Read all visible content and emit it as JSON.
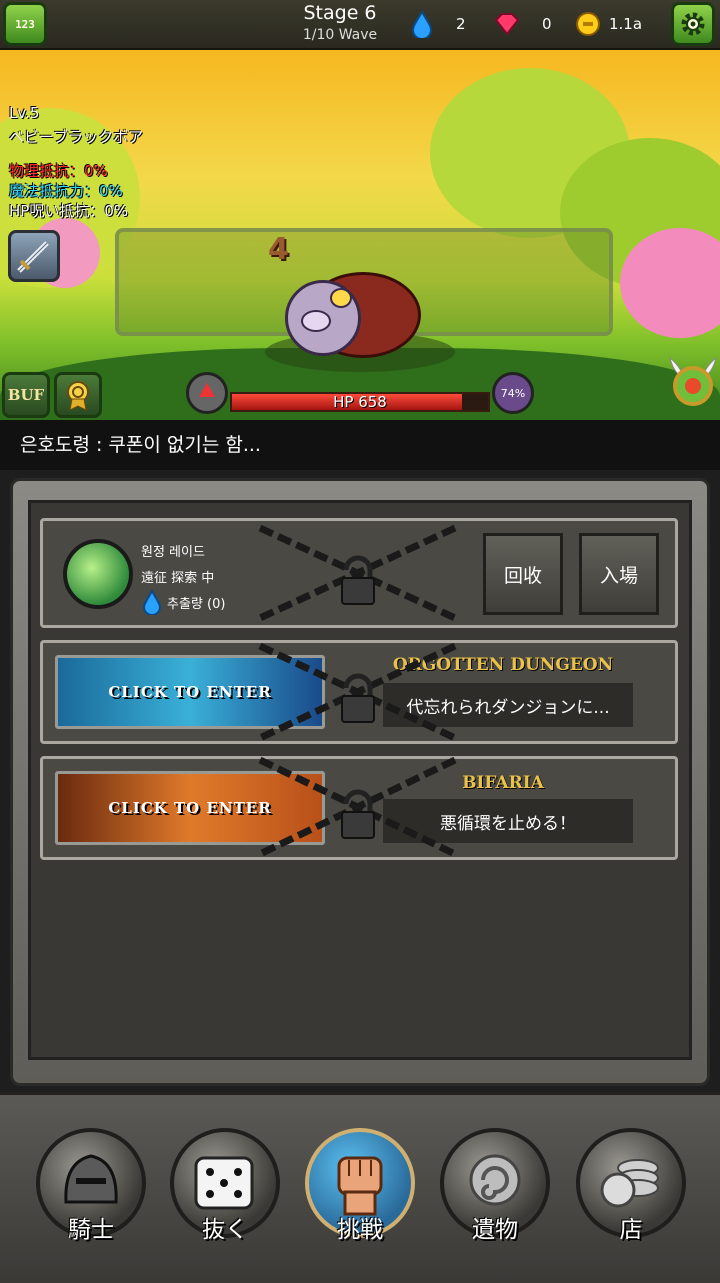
{
  "hud": {
    "menu_icon": "1-2-3-menu-icon",
    "stage_title": "Stage 6",
    "wave": "1/10 Wave",
    "water_count": "2",
    "gem_count": "0",
    "gold_count": "1.1a",
    "settings_icon": "gear-icon"
  },
  "enemy": {
    "level": "Lv.5",
    "name": "ベビーブラックボア",
    "physical_resist": "物理抵抗：0%",
    "magic_resist": "魔法抵抗力：0%",
    "hp_curse_resist": "HP呪い抵抗：0%",
    "hp_label": "HP 658",
    "hp_ratio": 0.9,
    "percent": "74%",
    "damage_float": "4"
  },
  "scene_buttons": {
    "buf_label": "BUF"
  },
  "chat": {
    "message": "은호도령 : 쿠폰이 없기는 함..."
  },
  "dungeons": {
    "raid": {
      "title": "원정 레이드",
      "status": "遠征 探索 中",
      "extraction": "추출량 (0)",
      "collect_button": "回收",
      "enter_button": "入場"
    },
    "forgotten": {
      "banner_text": "CLICK TO ENTER",
      "title": "ORGOTTEN DUNGEON",
      "description": "代忘れられダンジョンに..."
    },
    "bifaria": {
      "banner_text": "CLICK TO ENTER",
      "title": "BIFARIA",
      "description": "悪循環を止める！"
    }
  },
  "nav": [
    {
      "label": "騎士",
      "icon": "knight-helmet-icon"
    },
    {
      "label": "抜く",
      "icon": "dice-icon"
    },
    {
      "label": "挑戦",
      "icon": "fist-icon"
    },
    {
      "label": "遺物",
      "icon": "relic-swirl-icon"
    },
    {
      "label": "店",
      "icon": "coins-icon"
    }
  ],
  "colors": {
    "physical": "#ff2a2a",
    "magic": "#33d6ff",
    "gold_text": "#e9c24a"
  }
}
